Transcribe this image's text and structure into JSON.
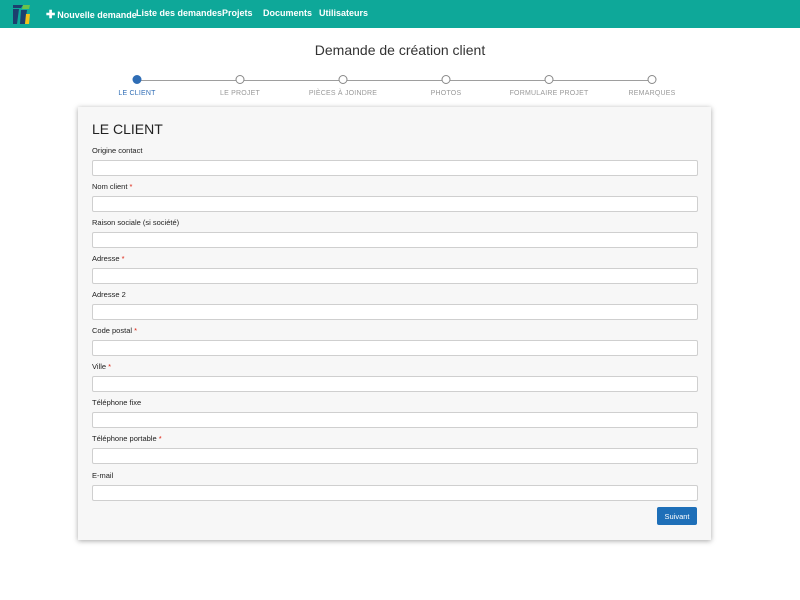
{
  "nav": {
    "items": [
      {
        "label": "Nouvelle demande",
        "icon": "plus-icon"
      },
      {
        "label": "Liste des demandes"
      },
      {
        "label": "Projets"
      },
      {
        "label": "Documents"
      },
      {
        "label": "Utilisateurs"
      }
    ],
    "bar_color": "#0ea899"
  },
  "page": {
    "title": "Demande de création client"
  },
  "stepper": {
    "steps": [
      {
        "label": "LE CLIENT",
        "active": true
      },
      {
        "label": "LE PROJET",
        "active": false
      },
      {
        "label": "PIÈCES À JOINDRE",
        "active": false
      },
      {
        "label": "PHOTOS",
        "active": false
      },
      {
        "label": "FORMULAIRE PROJET",
        "active": false
      },
      {
        "label": "REMARQUES",
        "active": false
      }
    ],
    "active_color": "#2f6db5"
  },
  "form": {
    "title": "LE CLIENT",
    "required_marker": "*",
    "fields": [
      {
        "label": "Origine contact",
        "required": false,
        "value": ""
      },
      {
        "label": "Nom client",
        "required": true,
        "value": ""
      },
      {
        "label": "Raison sociale (si société)",
        "required": false,
        "value": ""
      },
      {
        "label": "Adresse",
        "required": true,
        "value": ""
      },
      {
        "label": "Adresse 2",
        "required": false,
        "value": ""
      },
      {
        "label": "Code postal",
        "required": true,
        "value": ""
      },
      {
        "label": "Ville",
        "required": true,
        "value": ""
      },
      {
        "label": "Téléphone fixe",
        "required": false,
        "value": ""
      },
      {
        "label": "Téléphone portable",
        "required": true,
        "value": ""
      },
      {
        "label": "E-mail",
        "required": false,
        "value": ""
      }
    ],
    "next_label": "Suivant"
  }
}
